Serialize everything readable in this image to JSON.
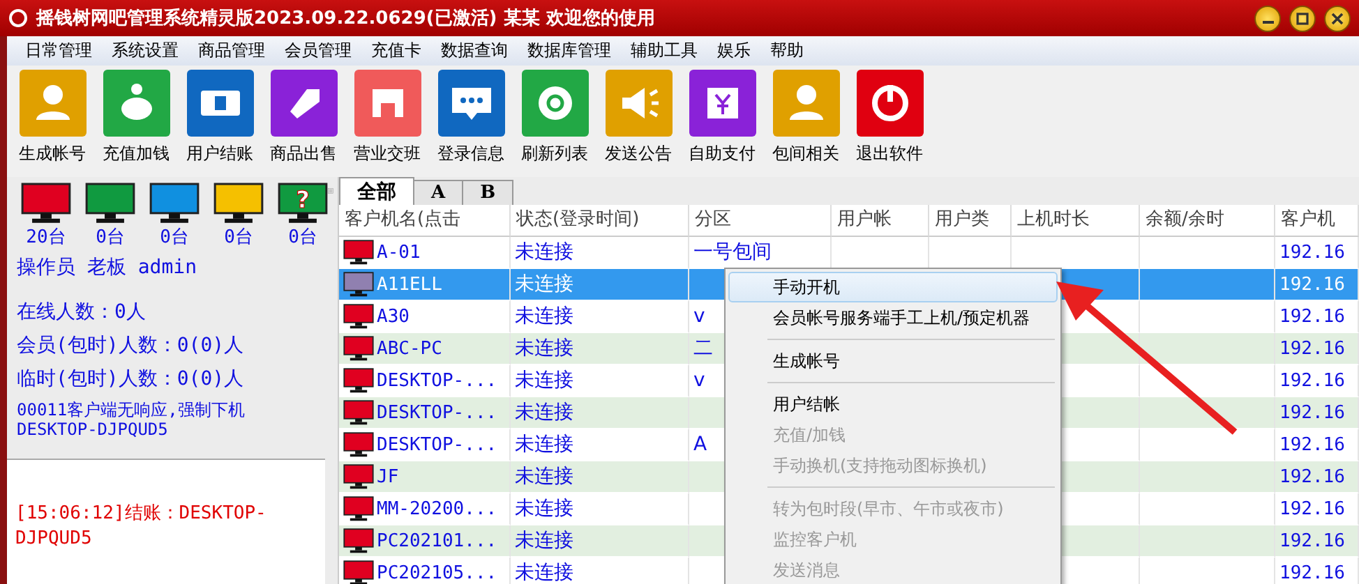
{
  "window": {
    "title": "摇钱树网吧管理系统精灵版2023.09.22.0629(已激活)  某某 欢迎您的使用"
  },
  "menu": [
    "日常管理",
    "系统设置",
    "商品管理",
    "会员管理",
    "充值卡",
    "数据查询",
    "数据库管理",
    "辅助工具",
    "娱乐",
    "帮助"
  ],
  "toolbar": [
    {
      "label": "生成帐号",
      "color": "#e0a000"
    },
    {
      "label": "充值加钱",
      "color": "#22a845"
    },
    {
      "label": "用户结账",
      "color": "#1068c0"
    },
    {
      "label": "商品出售",
      "color": "#8a22d8"
    },
    {
      "label": "营业交班",
      "color": "#f05a5a"
    },
    {
      "label": "登录信息",
      "color": "#1068c0"
    },
    {
      "label": "刷新列表",
      "color": "#22a845"
    },
    {
      "label": "发送公告",
      "color": "#e0a000"
    },
    {
      "label": "自助支付",
      "color": "#8a22d8"
    },
    {
      "label": "包间相关",
      "color": "#e0a000"
    },
    {
      "label": "退出软件",
      "color": "#e00010"
    }
  ],
  "status_monitors": [
    {
      "color": "#e00020",
      "count": "20台"
    },
    {
      "color": "#109a40",
      "count": "0台"
    },
    {
      "color": "#1090e0",
      "count": "0台"
    },
    {
      "color": "#f5c000",
      "count": "0台"
    },
    {
      "color": "#109a40",
      "count": "0台",
      "symbol": "?"
    }
  ],
  "operator": "操作员 老板 admin",
  "stats": [
    "在线人数：0人",
    "会员(包时)人数：0(0)人",
    "临时(包时)人数：0(0)人"
  ],
  "notice": "00011客户端无响应,强制下机 DESKTOP-DJPQUD5",
  "log": "[15:06:12]结账：DESKTOP-DJPQUD5",
  "tabs": [
    {
      "label": "全部",
      "selected": true
    },
    {
      "label": "A",
      "selected": false
    },
    {
      "label": "B",
      "selected": false
    }
  ],
  "table": {
    "columns": [
      "客户机名(点击",
      "状态(登录时间)",
      "分区",
      "用户帐",
      "用户类",
      "上机时长",
      "余额/余时",
      "客户机"
    ],
    "rows": [
      {
        "name": "A-01",
        "status": "未连接",
        "zone": "一号包间",
        "ip": "192.16",
        "selected": false
      },
      {
        "name": "A11ELL",
        "status": "未连接",
        "zone": "",
        "ip": "192.16",
        "selected": true
      },
      {
        "name": "A30",
        "status": "未连接",
        "zone": "v",
        "ip": "192.16",
        "selected": false
      },
      {
        "name": "ABC-PC",
        "status": "未连接",
        "zone": "二",
        "ip": "192.16",
        "selected": false
      },
      {
        "name": "DESKTOP-...",
        "status": "未连接",
        "zone": "v",
        "ip": "192.16",
        "selected": false
      },
      {
        "name": "DESKTOP-...",
        "status": "未连接",
        "zone": "",
        "ip": "192.16",
        "selected": false
      },
      {
        "name": "DESKTOP-...",
        "status": "未连接",
        "zone": "A",
        "ip": "192.16",
        "selected": false
      },
      {
        "name": "JF",
        "status": "未连接",
        "zone": "",
        "ip": "192.16",
        "selected": false
      },
      {
        "name": "MM-20200...",
        "status": "未连接",
        "zone": "",
        "ip": "192.16",
        "selected": false
      },
      {
        "name": "PC202101...",
        "status": "未连接",
        "zone": "",
        "ip": "192.16",
        "selected": false
      },
      {
        "name": "PC202105...",
        "status": "未连接",
        "zone": "",
        "ip": "192.16",
        "selected": false
      }
    ]
  },
  "context_menu": [
    {
      "kind": "item",
      "label": "手动开机",
      "selected": true,
      "disabled": false
    },
    {
      "kind": "item",
      "label": "会员帐号服务端手工上机/预定机器",
      "selected": false,
      "disabled": false
    },
    {
      "kind": "separator"
    },
    {
      "kind": "item",
      "label": "生成帐号",
      "selected": false,
      "disabled": false
    },
    {
      "kind": "separator"
    },
    {
      "kind": "item",
      "label": "用户结帐",
      "selected": false,
      "disabled": false
    },
    {
      "kind": "item",
      "label": "充值/加钱",
      "selected": false,
      "disabled": true
    },
    {
      "kind": "item",
      "label": "手动换机(支持拖动图标换机)",
      "selected": false,
      "disabled": true
    },
    {
      "kind": "separator"
    },
    {
      "kind": "item",
      "label": "转为包时段(早市、午市或夜市)",
      "selected": false,
      "disabled": true
    },
    {
      "kind": "item",
      "label": "监控客户机",
      "selected": false,
      "disabled": true
    },
    {
      "kind": "item",
      "label": "发送消息",
      "selected": false,
      "disabled": true
    }
  ]
}
